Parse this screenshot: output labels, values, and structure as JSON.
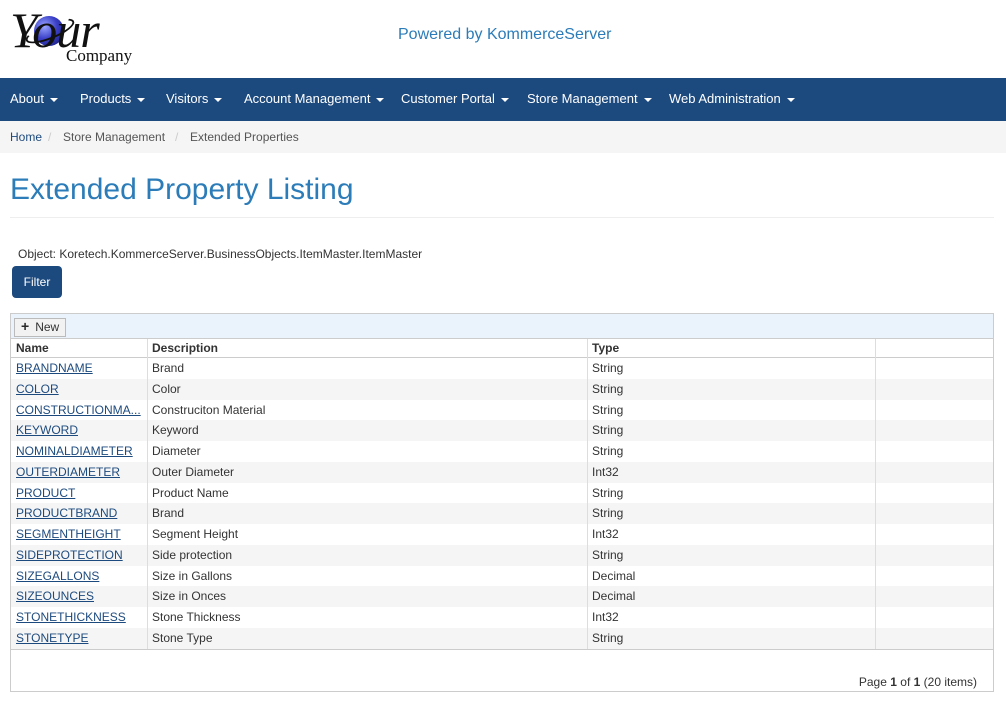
{
  "logo": {
    "word": "Your",
    "sub": "Company"
  },
  "powered_by": "Powered by KommerceServer",
  "nav": [
    "About",
    "Products",
    "Visitors",
    "Account Management",
    "Customer Portal",
    "Store Management",
    "Web Administration"
  ],
  "breadcrumb": [
    "Home",
    "Store Management",
    "Extended Properties"
  ],
  "page_title": "Extended Property Listing",
  "object": {
    "label": "Object:",
    "value": "Koretech.KommerceServer.BusinessObjects.ItemMaster.ItemMaster"
  },
  "filter_label": "Filter",
  "grid": {
    "new_label": "New",
    "columns": [
      "Name",
      "Description",
      "Type"
    ],
    "rows": [
      [
        "BRANDNAME",
        "Brand",
        "String"
      ],
      [
        "COLOR",
        "Color",
        "String"
      ],
      [
        "CONSTRUCTIONMA...",
        "Construciton Material",
        "String"
      ],
      [
        "KEYWORD",
        "Keyword",
        "String"
      ],
      [
        "NOMINALDIAMETER",
        "Diameter",
        "String"
      ],
      [
        "OUTERDIAMETER",
        "Outer Diameter",
        "Int32"
      ],
      [
        "PRODUCT",
        "Product Name",
        "String"
      ],
      [
        "PRODUCTBRAND",
        "Brand",
        "String"
      ],
      [
        "SEGMENTHEIGHT",
        "Segment Height",
        "Int32"
      ],
      [
        "SIDEPROTECTION",
        "Side protection",
        "String"
      ],
      [
        "SIZEGALLONS",
        "Size in Gallons",
        "Decimal"
      ],
      [
        "SIZEOUNCES",
        "Size in Onces",
        "Decimal"
      ],
      [
        "STONETHICKNESS",
        "Stone Thickness",
        "Int32"
      ],
      [
        "STONETYPE",
        "Stone Type",
        "String"
      ]
    ]
  },
  "pager": {
    "page_word": "Page",
    "page": "1",
    "of_word": "of",
    "pages": "1",
    "items": "(20 items)"
  },
  "colors": {
    "navbar": "#1d4a7e",
    "title": "#2b7cb8",
    "link": "#1d4a7e",
    "toolbar": "#eaf2fb"
  }
}
